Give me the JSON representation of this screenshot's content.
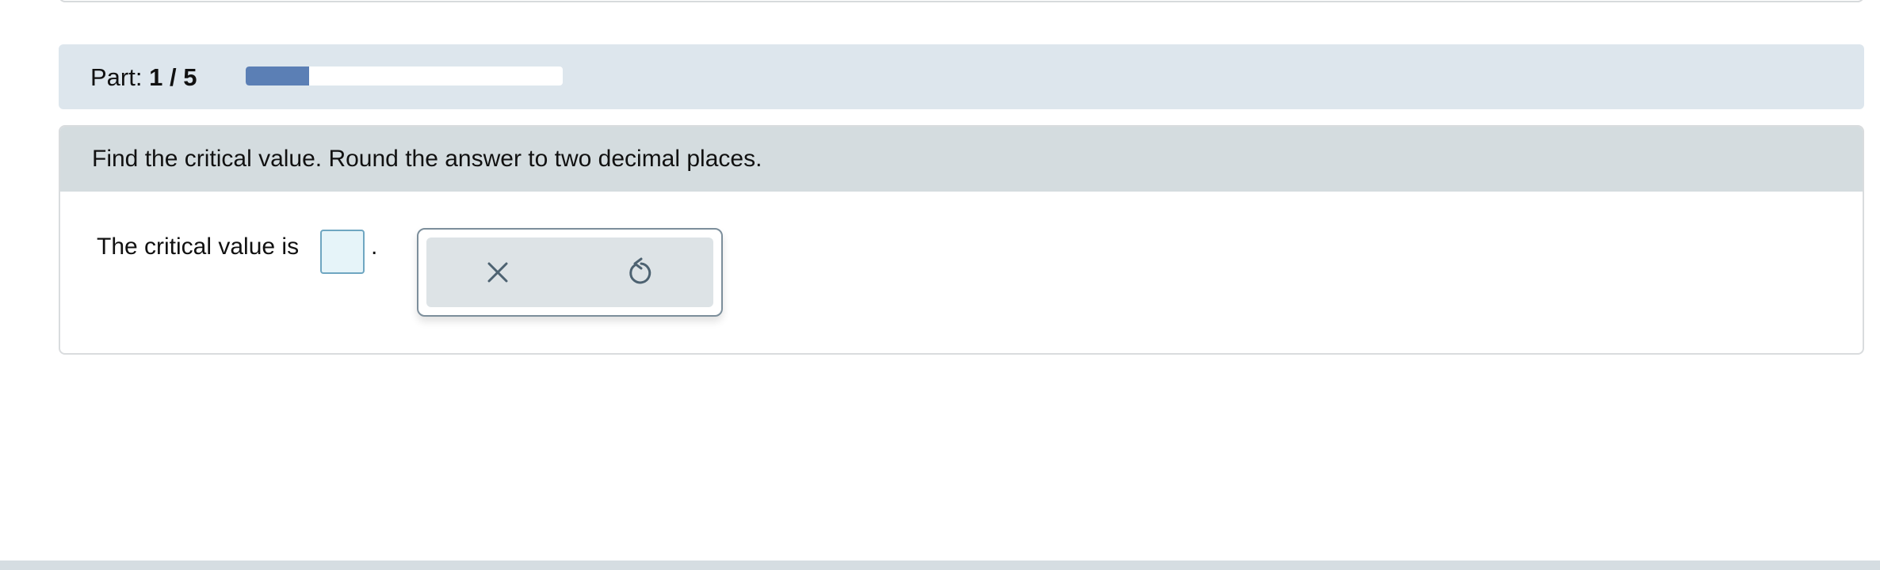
{
  "part": {
    "label": "Part:",
    "current": "1",
    "separator": "/",
    "total": "5",
    "progress_fraction": 0.2,
    "progress_color": "#5b7fb5"
  },
  "question": {
    "instruction": "Find the critical value. Round the answer to two decimal places.",
    "prompt": "The critical value is",
    "answer_value": "",
    "trailing": "."
  },
  "tools": {
    "clear_icon": "close-icon",
    "undo_icon": "undo-icon"
  }
}
